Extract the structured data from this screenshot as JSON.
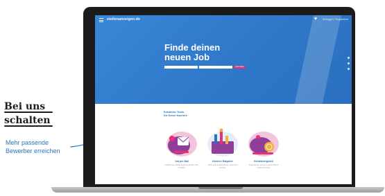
{
  "annotation": {
    "heading_line1": "Bei uns",
    "heading_line2": "schalten",
    "note_line1": "Mehr passende",
    "note_line2": "Bewerber erreichen"
  },
  "site": {
    "logo": "stellenanzeigen.de",
    "login_label": "Einloggen / Registrieren",
    "hero": {
      "title_line1": "Finde deinen",
      "title_line2": "neuen Job",
      "search_button": "Jobs finden"
    },
    "section_title_line1": "Entdecke Tools",
    "section_title_line2": "für Deine Karriere",
    "cards": [
      {
        "title": "Job per Mail",
        "text": "Erhalte neue Stellenangebote direkt in dein Postfach."
      },
      {
        "title": "Karriere-Ratgeber",
        "text": "Tipps rund um Bewerbung, Gehalt und Karriere."
      },
      {
        "title": "Gehaltsvergleich",
        "text": "Finde heraus, was du in deinem Beruf verdienen kannst."
      }
    ]
  },
  "colors": {
    "hero_blue": "#2f78c9",
    "accent_pink": "#e4327a",
    "note_blue": "#2a73bf"
  }
}
